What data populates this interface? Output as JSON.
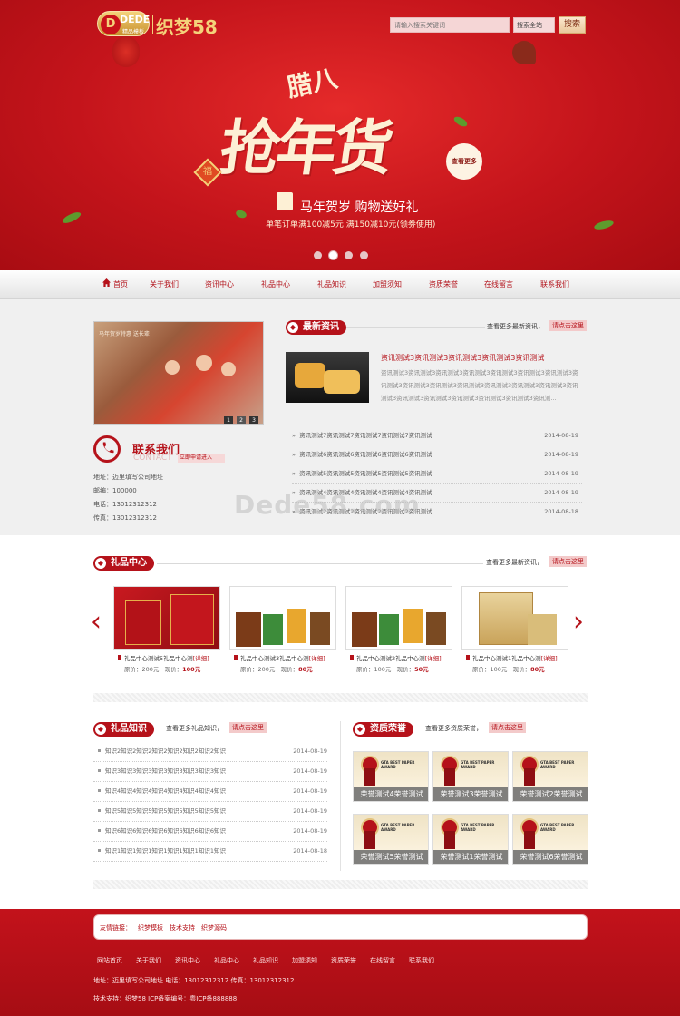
{
  "header": {
    "logo_text": "DEDE",
    "logo_sub": "精品模板",
    "logo_cn": "织梦58",
    "search_placeholder": "请输入搜索关键词",
    "search_scope": "搜索全站",
    "search_button": "搜索"
  },
  "banner": {
    "top_word": "腊八",
    "main_text": "抢年货",
    "more": "查看更多",
    "fu": "福",
    "line1": "马年贺岁 购物送好礼",
    "line2": "单笔订单满100减5元 满150减10元(领劵使用)",
    "slides": 4,
    "active_slide": 2
  },
  "nav": {
    "items": [
      "首页",
      "关于我们",
      "资讯中心",
      "礼品中心",
      "礼品知识",
      "加盟须知",
      "资质荣誉",
      "在线留言",
      "联系我们"
    ]
  },
  "photo": {
    "caption": "马年贺岁特惠  送长辈",
    "pages": [
      "1",
      "2",
      "3"
    ]
  },
  "contact": {
    "title": "联系我们",
    "en": "CONTACT",
    "tag": "立即申请进入",
    "address": "地址：迈里填写公司地址",
    "zip": "邮编：100000",
    "phone": "电话：13012312312",
    "fax": "传真：13012312312"
  },
  "news": {
    "title": "最新资讯",
    "more": "查看更多最新资讯，",
    "click": "请点击这里",
    "featured_title": "资讯测试3资讯测试3资讯测试3资讯测试3资讯测试",
    "featured_desc": "资讯测试3资讯测试3资讯测试3资讯测试3资讯测试3资讯测试3资讯测试3资讯测试3资讯测试3资讯测试3资讯测试3资讯测试3资讯测试3资讯测试3资讯测试3资讯测试3资讯测试3资讯测试3资讯测试3资讯测试3资讯测...",
    "items": [
      {
        "title": "资讯测试7资讯测试7资讯测试7资讯测试7资讯测试",
        "date": "2014-08-19"
      },
      {
        "title": "资讯测试6资讯测试6资讯测试6资讯测试6资讯测试",
        "date": "2014-08-19"
      },
      {
        "title": "资讯测试5资讯测试5资讯测试5资讯测试5资讯测试",
        "date": "2014-08-19"
      },
      {
        "title": "资讯测试4资讯测试4资讯测试4资讯测试4资讯测试",
        "date": "2014-08-19"
      },
      {
        "title": "资讯测试2资讯测试2资讯测试2资讯测试2资讯测试",
        "date": "2014-08-18"
      }
    ]
  },
  "watermark": "Dede58.com",
  "gifts": {
    "title": "礼品中心",
    "more": "查看更多最新资讯，",
    "click": "请点击这里",
    "prev": "‹",
    "next": "›",
    "items": [
      {
        "name": "礼品中心测试5礼品中心测",
        "detail": "[详细]",
        "orig": "原价：200元",
        "now_label": "现价：",
        "now": "100元"
      },
      {
        "name": "礼品中心测试3礼品中心测",
        "detail": "[详细]",
        "orig": "原价：200元",
        "now_label": "现价：",
        "now": "80元"
      },
      {
        "name": "礼品中心测试2礼品中心测",
        "detail": "[详细]",
        "orig": "原价：100元",
        "now_label": "现价：",
        "now": "50元"
      },
      {
        "name": "礼品中心测试1礼品中心测",
        "detail": "[详细]",
        "orig": "原价：100元",
        "now_label": "现价：",
        "now": "80元"
      }
    ]
  },
  "knowledge": {
    "title": "礼品知识",
    "more": "查看更多礼品知识，",
    "click": "请点击这里",
    "items": [
      {
        "title": "知识2知识2知识2知识2知识2知识2知识2知识",
        "date": "2014-08-19"
      },
      {
        "title": "知识3知识3知识3知识3知识3知识3知识3知识",
        "date": "2014-08-19"
      },
      {
        "title": "知识4知识4知识4知识4知识4知识4知识4知识",
        "date": "2014-08-19"
      },
      {
        "title": "知识5知识5知识5知识5知识5知识5知识5知识",
        "date": "2014-08-19"
      },
      {
        "title": "知识6知识6知识6知识6知识6知识6知识6知识",
        "date": "2014-08-19"
      },
      {
        "title": "知识1知识1知识1知识1知识1知识1知识1知识",
        "date": "2014-08-18"
      }
    ]
  },
  "honors": {
    "title": "资质荣誉",
    "more": "查看更多资质荣誉，",
    "click": "请点击这里",
    "award": "GTA BEST PAPER AWARD",
    "logo": "LOGO",
    "items": [
      "荣誉测试4荣誉测试",
      "荣誉测试3荣誉测试",
      "荣誉测试2荣誉测试",
      "荣誉测试5荣誉测试",
      "荣誉测试1荣誉测试",
      "荣誉测试6荣誉测试"
    ]
  },
  "footer": {
    "links_label": "友情链接：",
    "links": [
      "织梦模板",
      "技术支持",
      "织梦源码"
    ],
    "nav": [
      "网站首页",
      "关于我们",
      "资讯中心",
      "礼品中心",
      "礼品知识",
      "加盟须知",
      "资质荣誉",
      "在线留言",
      "联系我们"
    ],
    "address_line": "地址：迈里填写公司地址  电话：13012312312  传真：13012312312",
    "tech_line": "技术支持：织梦58    ICP备案编号：粤ICP备888888"
  },
  "colors": {
    "brand": "#b5121a",
    "banner": "#c4141b",
    "gold": "#f4d27a"
  }
}
